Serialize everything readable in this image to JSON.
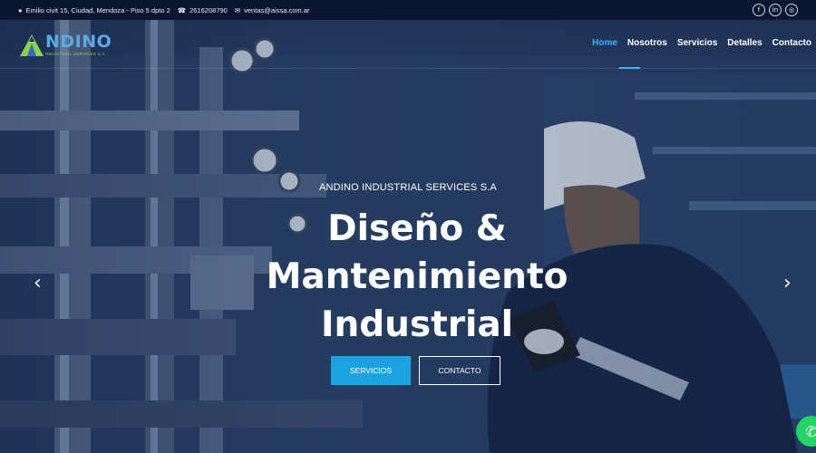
{
  "topbar": {
    "address": "Emilio civit 15, Ciudad, Mendoza - Piso 5 dpto 2",
    "phone": "2616208790",
    "email": "ventas@aissa.com.ar",
    "social": [
      {
        "icon": "facebook-icon",
        "glyph": "f"
      },
      {
        "icon": "linkedin-icon",
        "glyph": "in"
      },
      {
        "icon": "instagram-icon",
        "glyph": "◎"
      }
    ]
  },
  "brand": {
    "name": "NDINO",
    "sub": "INDUSTRIAL SERVICES S.A",
    "colors": {
      "blue": "#5aa9e6",
      "green": "#8fd14f"
    }
  },
  "nav": {
    "items": [
      {
        "label": "Home",
        "active": true
      },
      {
        "label": "Nosotros"
      },
      {
        "label": "Servicios"
      },
      {
        "label": "Detalles"
      },
      {
        "label": "Contacto"
      }
    ],
    "active_color": "#38b6ff"
  },
  "hero": {
    "eyebrow": "ANDINO INDUSTRIAL SERVICES S.A",
    "headline_lines": [
      "Diseño &",
      "Mantenimiento",
      "Industrial"
    ],
    "primary_button": "SERVICIOS",
    "secondary_button": "CONTACTO",
    "prev_glyph": "‹",
    "next_glyph": "›"
  },
  "whatsapp": {
    "icon": "whatsapp-icon",
    "color": "#25d366"
  }
}
